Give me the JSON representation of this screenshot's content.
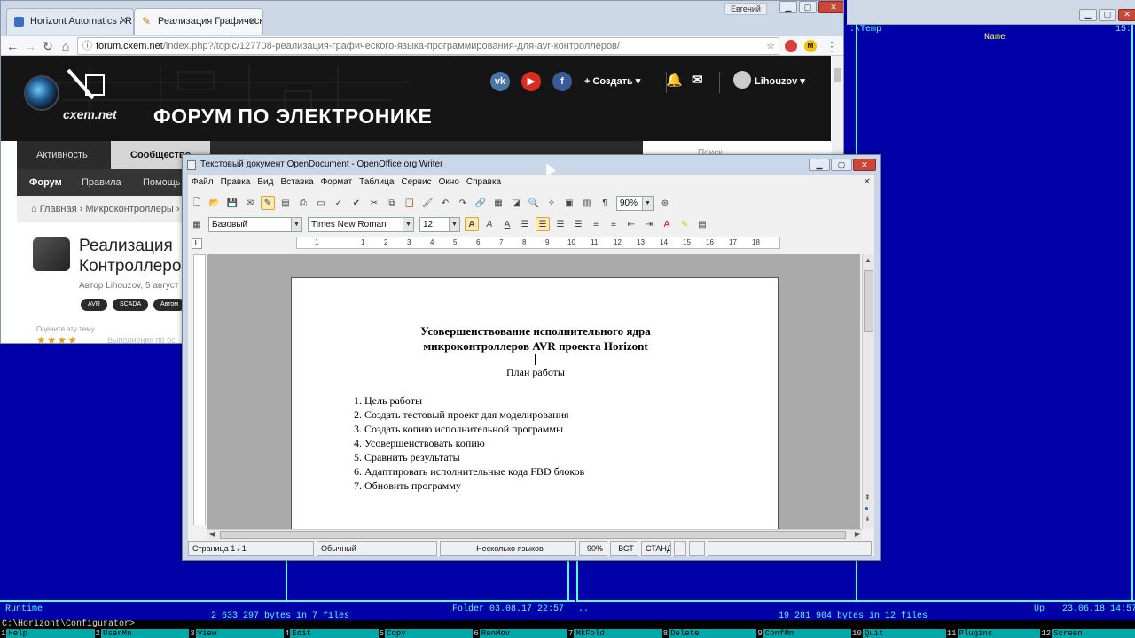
{
  "far": {
    "right_path": ":\\Temp",
    "right_header": "Name",
    "left_info_name": "Runtime",
    "left_summary": "2 633 297 bytes in 7 files",
    "left_folder": "Folder 03.08.17 22:57",
    "right_up_name": "..",
    "right_summary": "19 281 904 bytes in 12 files",
    "right_up": "Up",
    "right_date": "23.06.18 14:57",
    "prompt": "C:\\Horizont\\Configurator>",
    "right_corner": "15:",
    "fkeys": [
      {
        "n": "1",
        "label": "Help"
      },
      {
        "n": "2",
        "label": "UserMn"
      },
      {
        "n": "3",
        "label": "View"
      },
      {
        "n": "4",
        "label": "Edit"
      },
      {
        "n": "5",
        "label": "Copy"
      },
      {
        "n": "6",
        "label": "RenMov"
      },
      {
        "n": "7",
        "label": "MkFold"
      },
      {
        "n": "8",
        "label": "Delete"
      },
      {
        "n": "9",
        "label": "ConfMn"
      },
      {
        "n": "10",
        "label": "Quit"
      },
      {
        "n": "11",
        "label": "Plugins"
      },
      {
        "n": "12",
        "label": "Screen"
      }
    ]
  },
  "chrome": {
    "user": "Евгений",
    "tabs": [
      {
        "label": "Horizont Automatics / R",
        "active": false
      },
      {
        "label": "Реализация Графическо",
        "active": true
      }
    ],
    "url_host": "forum.cxem.net",
    "url_path": "/index.php?/topic/127708-реализация-графического-языка-программирования-для-avr-контроллеров/"
  },
  "site": {
    "logo_text": "cxem.net",
    "slogan": "ФОРУМ ПО ЭЛЕКТРОНИКЕ",
    "create": "+ Создать ▾",
    "user": "Lihouzov ▾",
    "nav": [
      "Активность",
      "Сообщество"
    ],
    "subnav": [
      "Форум",
      "Правила",
      "Помощь в"
    ],
    "search_placeholder": "Поиск...",
    "breadcrumb": "Главная › Микроконтроллеры ›",
    "topic_title_1": "Реализация",
    "topic_title_2": "Контроллеров",
    "author": "Автор Lihouzov, 5 август",
    "tags": [
      "AVR",
      "SCADA",
      "Автом"
    ],
    "rate_label": "Оцените эту тему",
    "stars": "★★★★",
    "faded": "Выполнения по ос"
  },
  "writer": {
    "title": "Текстовый документ OpenDocument - OpenOffice.org Writer",
    "menu": [
      "Файл",
      "Правка",
      "Вид",
      "Вставка",
      "Формат",
      "Таблица",
      "Сервис",
      "Окно",
      "Справка"
    ],
    "zoom": "90%",
    "style": "Базовый",
    "font": "Times New Roman",
    "size": "12",
    "ruler": [
      "1",
      "1",
      "2",
      "3",
      "4",
      "5",
      "6",
      "7",
      "8",
      "9",
      "10",
      "11",
      "12",
      "13",
      "14",
      "15",
      "16",
      "17",
      "18"
    ],
    "doc": {
      "title_line1": "Усовершенствование исполнительного ядра",
      "title_line2": "микроконтроллеров AVR проекта Horizont",
      "subtitle": "План работы",
      "items": [
        "1.  Цель работы",
        "2.  Создать тестовый проект для моделирования",
        "3.  Создать копию исполнительной программы",
        "4.  Усовершенствовать копию",
        "5.  Сравнить результаты",
        "6.  Адаптировать исполнительные кода FBD блоков",
        "7.  Обновить программу"
      ]
    },
    "status": {
      "page": "Страница  1 / 1",
      "style": "Обычный",
      "lang": "Несколько языков",
      "zoom": "90%",
      "insert": "ВСТ",
      "select": "СТАНД"
    }
  }
}
